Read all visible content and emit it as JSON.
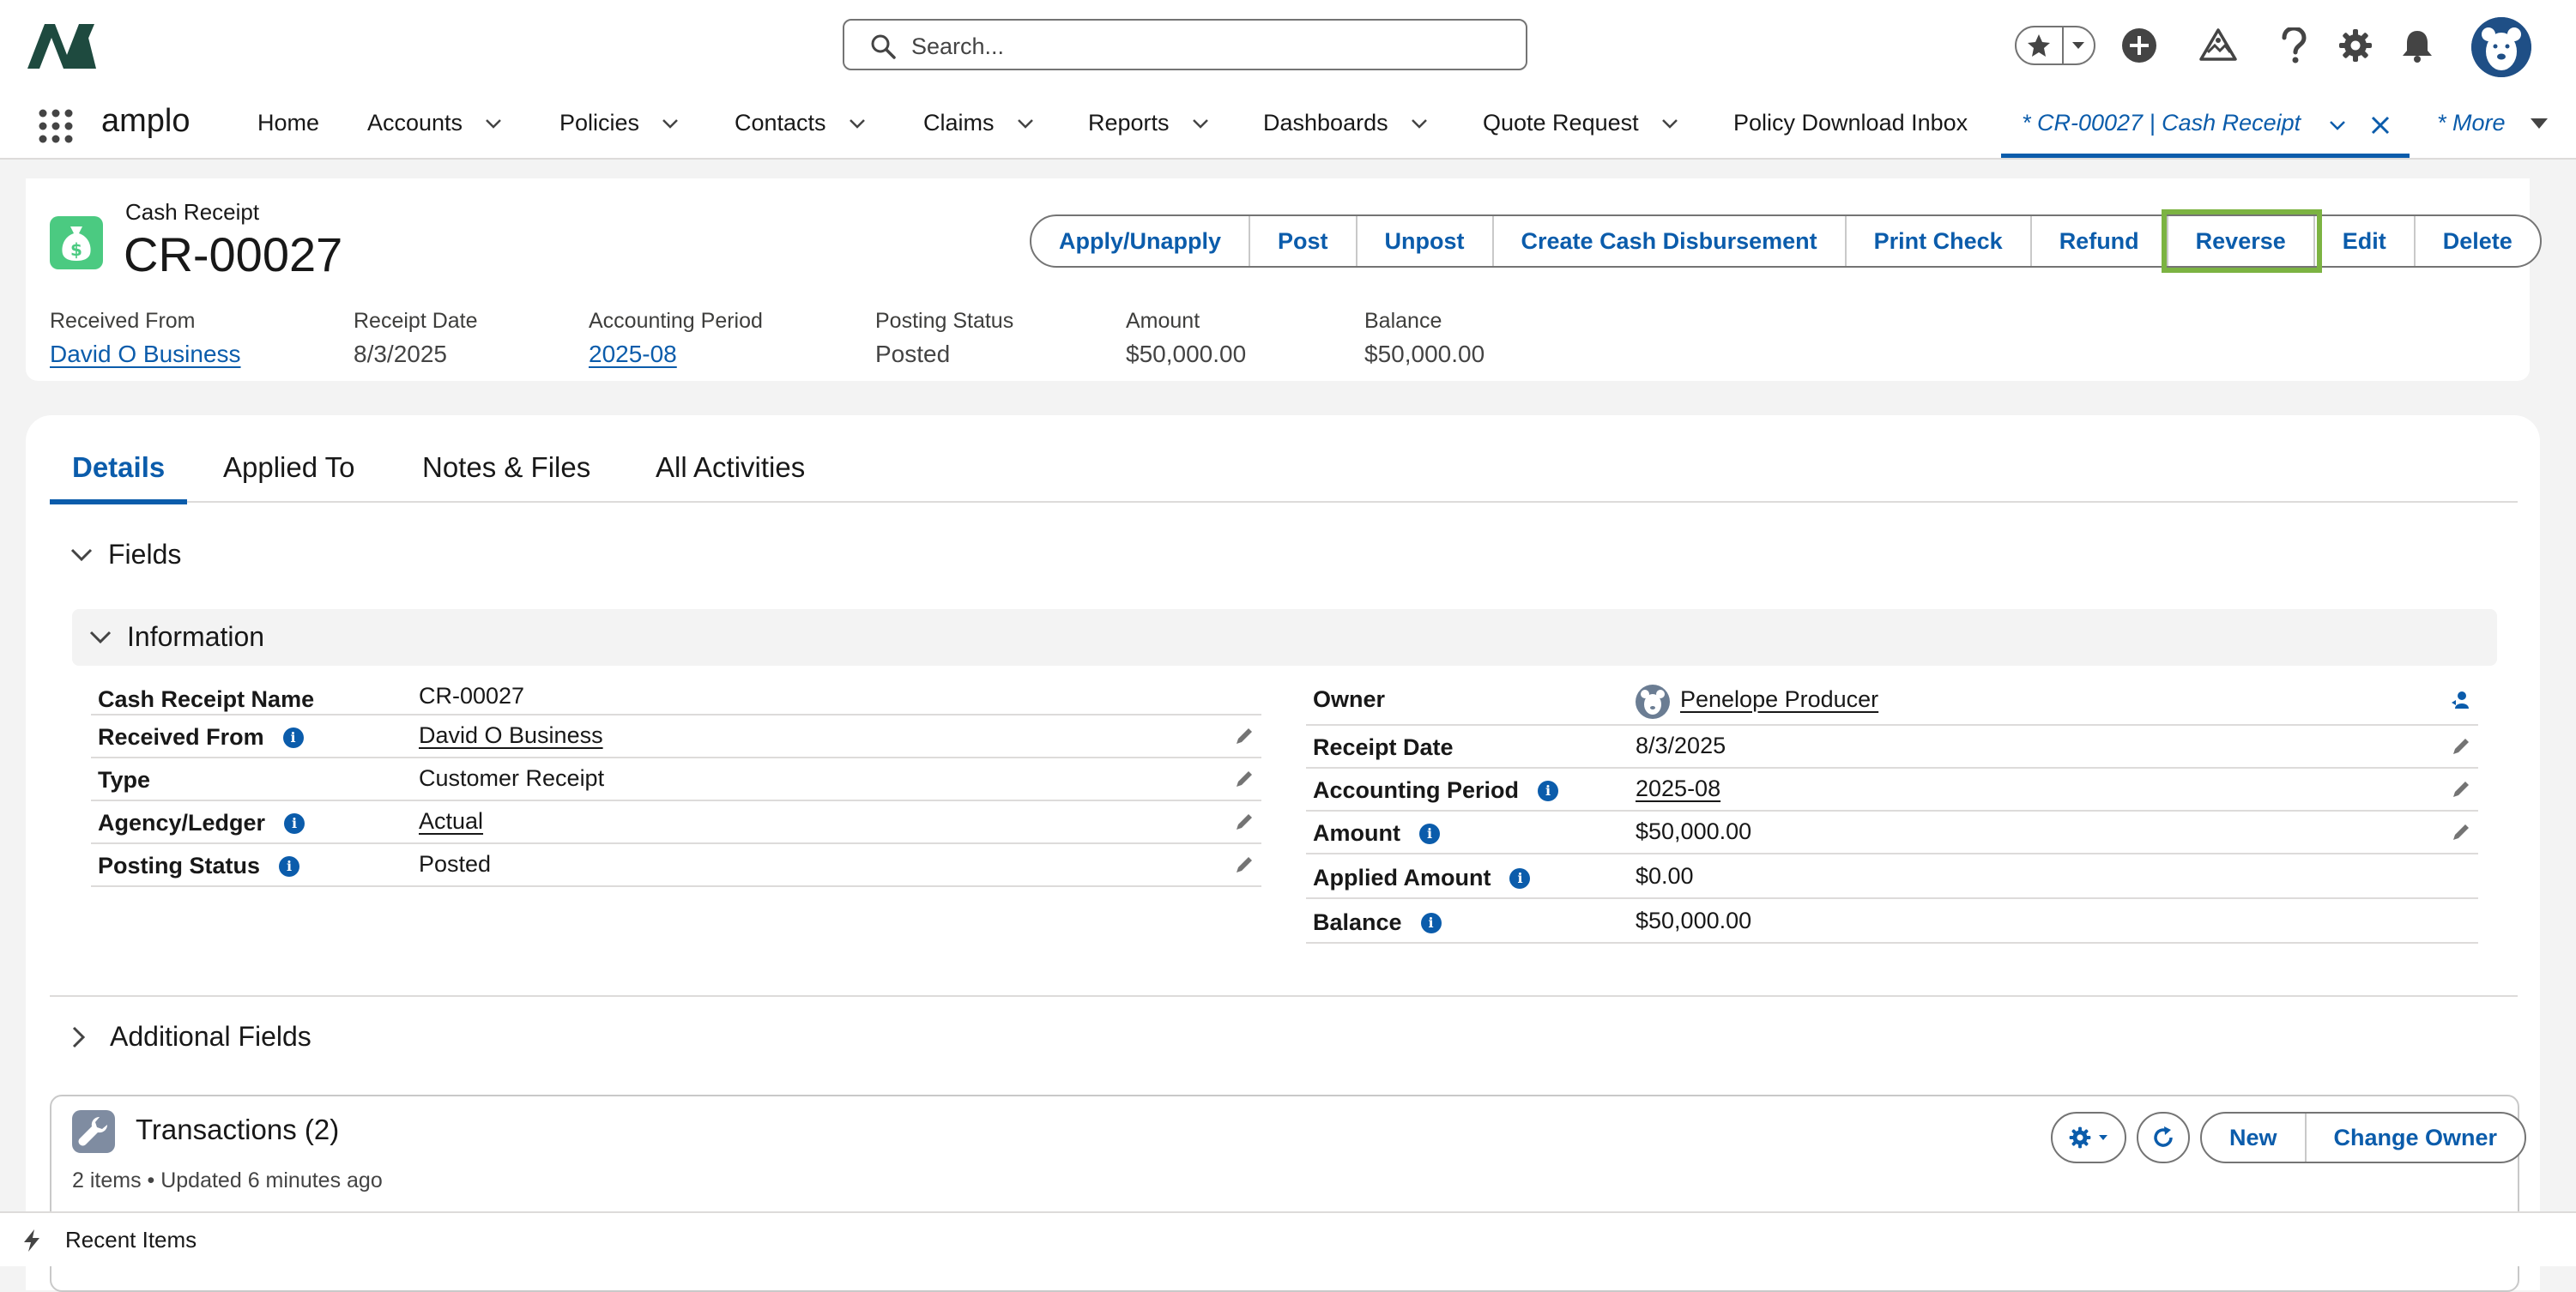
{
  "header": {
    "search_placeholder": "Search..."
  },
  "nav": {
    "app_name": "amplo",
    "items": [
      {
        "label": "Home"
      },
      {
        "label": "Accounts"
      },
      {
        "label": "Policies"
      },
      {
        "label": "Contacts"
      },
      {
        "label": "Claims"
      },
      {
        "label": "Reports"
      },
      {
        "label": "Dashboards"
      },
      {
        "label": "Quote Request"
      },
      {
        "label": "Policy Download Inbox"
      }
    ],
    "active_tab": "* CR-00027 | Cash Receipt",
    "more_label": "* More"
  },
  "record": {
    "type": "Cash Receipt",
    "name": "CR-00027",
    "actions": [
      "Apply/Unapply",
      "Post",
      "Unpost",
      "Create Cash Disbursement",
      "Print Check",
      "Refund",
      "Reverse",
      "Edit",
      "Delete"
    ],
    "highlights": [
      {
        "label": "Received From",
        "value": "David O Business",
        "link": true
      },
      {
        "label": "Receipt Date",
        "value": "8/3/2025",
        "link": false
      },
      {
        "label": "Accounting Period",
        "value": "2025-08",
        "link": true
      },
      {
        "label": "Posting Status",
        "value": "Posted",
        "link": false
      },
      {
        "label": "Amount",
        "value": "$50,000.00",
        "link": false
      },
      {
        "label": "Balance",
        "value": "$50,000.00",
        "link": false
      }
    ]
  },
  "tabs": [
    "Details",
    "Applied To",
    "Notes & Files",
    "All Activities"
  ],
  "sections": {
    "fields": "Fields",
    "information": "Information",
    "additional": "Additional Fields"
  },
  "left_fields": [
    {
      "label": "Cash Receipt Name",
      "value": "CR-00027"
    },
    {
      "label": "Received From",
      "value": "David O Business"
    },
    {
      "label": "Type",
      "value": "Customer Receipt"
    },
    {
      "label": "Agency/Ledger",
      "value": "Actual"
    },
    {
      "label": "Posting Status",
      "value": "Posted"
    }
  ],
  "right_fields": [
    {
      "label": "Owner",
      "value": "Penelope Producer"
    },
    {
      "label": "Receipt Date",
      "value": "8/3/2025"
    },
    {
      "label": "Accounting Period",
      "value": "2025-08"
    },
    {
      "label": "Amount",
      "value": "$50,000.00"
    },
    {
      "label": "Applied Amount",
      "value": "$0.00"
    },
    {
      "label": "Balance",
      "value": "$50,000.00"
    }
  ],
  "transactions": {
    "title": "Transactions (2)",
    "subtitle": "2 items • Updated 6 minutes ago",
    "new_label": "New",
    "change_owner_label": "Change Owner"
  },
  "utility": {
    "recent_items": "Recent Items"
  },
  "colors": {
    "brand_blue": "#0b5cab",
    "highlight_green": "#7cb342",
    "record_icon_green": "#4bca81"
  }
}
